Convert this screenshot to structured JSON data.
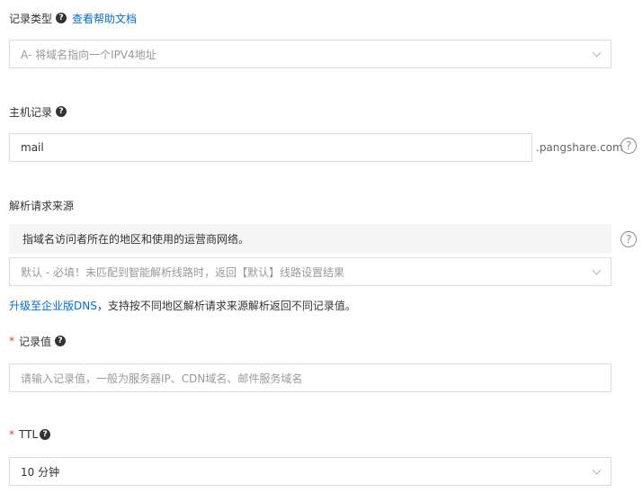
{
  "record_type": {
    "label": "记录类型",
    "help_icon": "question-icon",
    "help_link": "查看帮助文档",
    "selected": "A- 将域名指向一个IPV4地址"
  },
  "host_record": {
    "label": "主机记录",
    "help_icon": "question-icon",
    "value": "mail",
    "suffix": ".pangshare.com",
    "side_help_icon": "circle-question-icon"
  },
  "resolve_source": {
    "label": "解析请求来源",
    "info_text": "指域名访问者所在的地区和使用的运营商网络。",
    "selected": "默认 - 必填！未匹配到智能解析线路时，返回【默认】线路设置结果",
    "side_help_icon": "circle-question-icon",
    "upgrade_link": "升级至企业版DNS",
    "upgrade_text": "，支持按不同地区解析请求来源解析返回不同记录值。"
  },
  "record_value": {
    "required_mark": "*",
    "label": "记录值",
    "help_icon": "question-icon",
    "placeholder": "请输入记录值，一般为服务器IP、CDN域名、邮件服务域名"
  },
  "ttl": {
    "required_mark": "*",
    "label": "TTL",
    "help_icon": "question-icon",
    "selected": "10 分钟"
  }
}
